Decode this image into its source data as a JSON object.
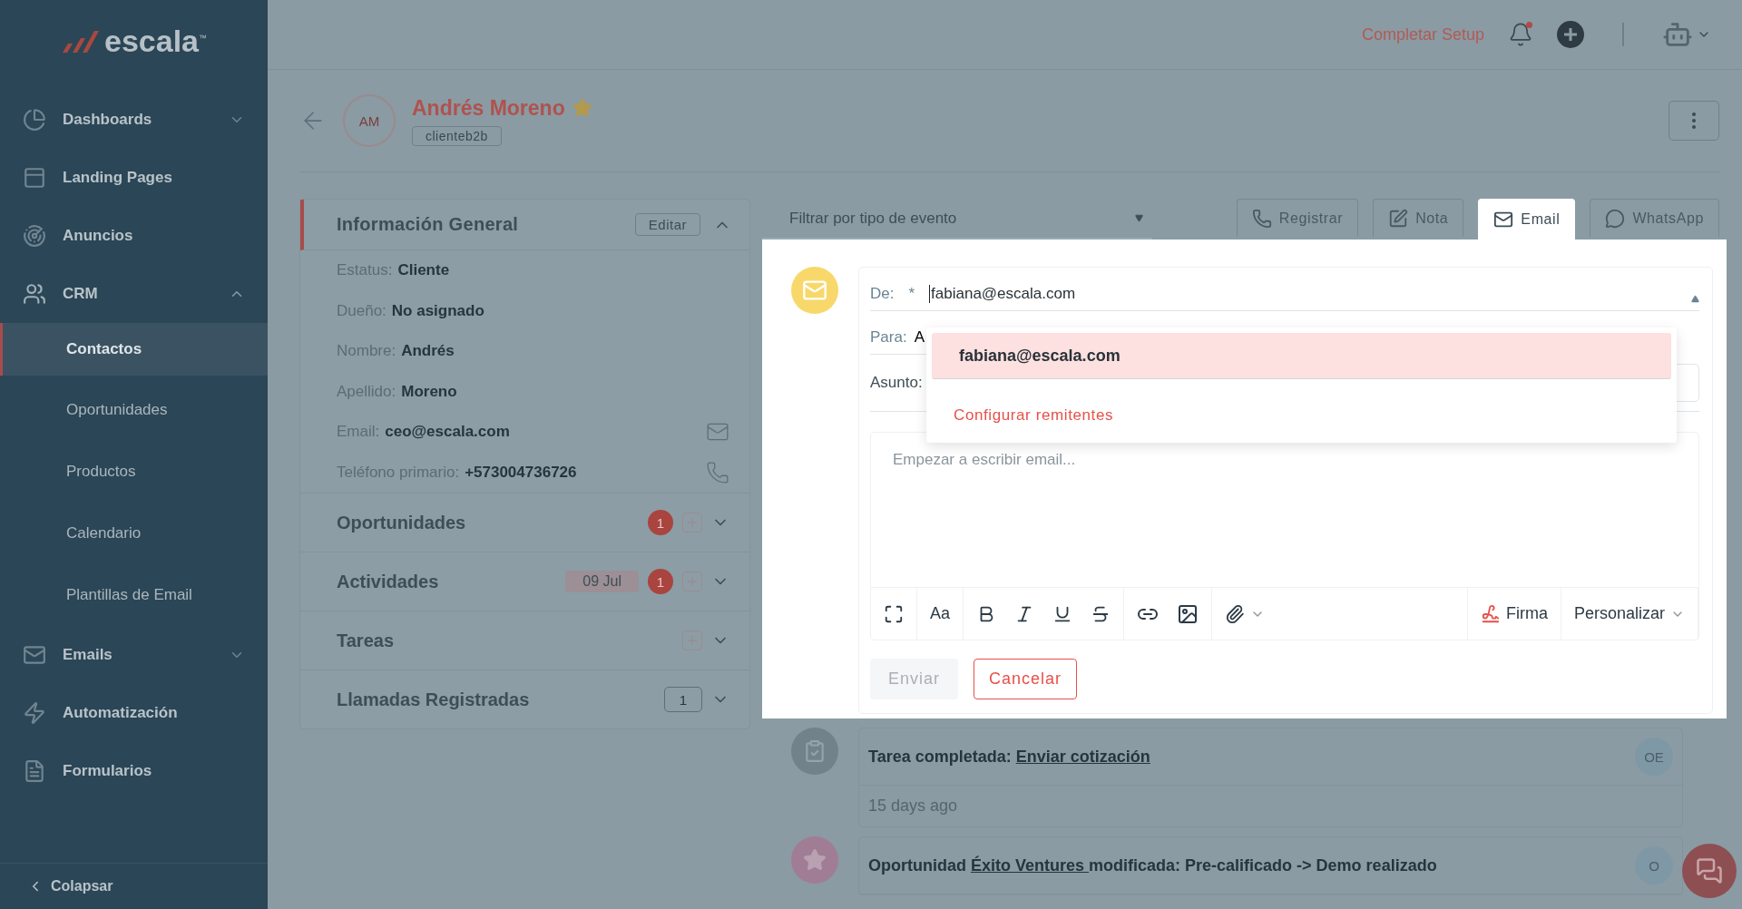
{
  "sidebar": {
    "logo": "escala$^{™}$",
    "items": [
      {
        "label": "Dashboards",
        "kind": "group",
        "expanded": false,
        "selected": false
      },
      {
        "label": "Landing Pages",
        "kind": "link",
        "selected": false
      },
      {
        "label": "Anuncios",
        "kind": "link",
        "selected": false
      },
      {
        "label": "CRM",
        "kind": "group",
        "expanded": true,
        "selected": false,
        "children": [
          {
            "label": "Contactos",
            "selected": true
          },
          {
            "label": "Oportunidades",
            "selected": false
          },
          {
            "label": "Productos",
            "selected": false
          },
          {
            "label": "Calendario",
            "selected": false
          },
          {
            "label": "Plantillas de Email",
            "selected": false
          }
        ]
      },
      {
        "label": "Emails",
        "kind": "group",
        "expanded": false,
        "selected": false
      },
      {
        "label": "Automatización",
        "kind": "link",
        "selected": false
      },
      {
        "label": "Formularios",
        "kind": "link",
        "selected": false
      }
    ],
    "collapse": "Colapsar"
  },
  "header": {
    "setup_link": "Completar Setup",
    "notification_dot": true
  },
  "contact": {
    "initials": "AM",
    "name": "Andrés Moreno",
    "starred": true,
    "tag": "clienteb2b"
  },
  "info_panel": {
    "title": "Información General",
    "edit": "Editar",
    "expanded": true,
    "fields": [
      {
        "label": "Estatus:",
        "value": "Cliente"
      },
      {
        "label": "Dueño:",
        "value": "No asignado"
      },
      {
        "label": "Nombre:",
        "value": "Andrés"
      },
      {
        "label": "Apellido:",
        "value": "Moreno"
      },
      {
        "label": "Email:",
        "value": "ceo@escala.com",
        "kind": "email"
      },
      {
        "label": "Teléfono primario:",
        "value": "+573004736726",
        "kind": "phone"
      }
    ]
  },
  "sections": [
    {
      "title": "Oportunidades",
      "count": "1",
      "kind": "badge",
      "addable": true,
      "expanded": false
    },
    {
      "title": "Actividades",
      "date": "09 Jul",
      "count": "1",
      "kind": "badge",
      "addable": true,
      "expanded": false
    },
    {
      "title": "Tareas",
      "addable": true,
      "expanded": false
    },
    {
      "title": "Llamadas Registradas",
      "count": "1",
      "kind": "outline",
      "addable": false,
      "expanded": false
    }
  ],
  "filter": {
    "placeholder": "Filtrar por tipo de evento"
  },
  "tabs": [
    {
      "label": "Registrar",
      "selected": false
    },
    {
      "label": "Nota",
      "selected": false
    },
    {
      "label": "Email",
      "selected": true
    },
    {
      "label": "WhatsApp",
      "selected": false
    }
  ],
  "composer": {
    "from_label": "De:",
    "required_mark": "*",
    "from_value": "fabiana@escala.com",
    "to_label": "Para:",
    "to_value": "A",
    "subject_label": "Asunto:",
    "body_placeholder": "Empezar a escribir email...",
    "toolbar": [
      {
        "kind": "expand"
      },
      {
        "kind": "text",
        "label": "Aa"
      },
      {
        "kind": "bold"
      },
      {
        "kind": "italic"
      },
      {
        "kind": "underline"
      },
      {
        "kind": "strike"
      },
      {
        "kind": "link"
      },
      {
        "kind": "image"
      },
      {
        "kind": "attach"
      },
      {
        "kind": "signature",
        "label": "Firma"
      },
      {
        "kind": "menu",
        "label": "Personalizar"
      }
    ],
    "send": {
      "label": "Enviar",
      "disabled": true
    },
    "cancel": "Cancelar",
    "dropdown": {
      "options": [
        {
          "label": "fabiana@escala.com",
          "selected": true
        }
      ],
      "action": "Configurar remitentes"
    }
  },
  "timeline": [
    {
      "kind": "task",
      "prefix": "Tarea completada: ",
      "link": "Enviar cotización",
      "user": "OE",
      "time": "15 days ago"
    },
    {
      "kind": "opportunity",
      "prefix": "Oportunidad ",
      "link": "Éxito Ventures ",
      "suffix": " modificada: Pre-calificado -> Demo realizado",
      "user": "O"
    }
  ]
}
